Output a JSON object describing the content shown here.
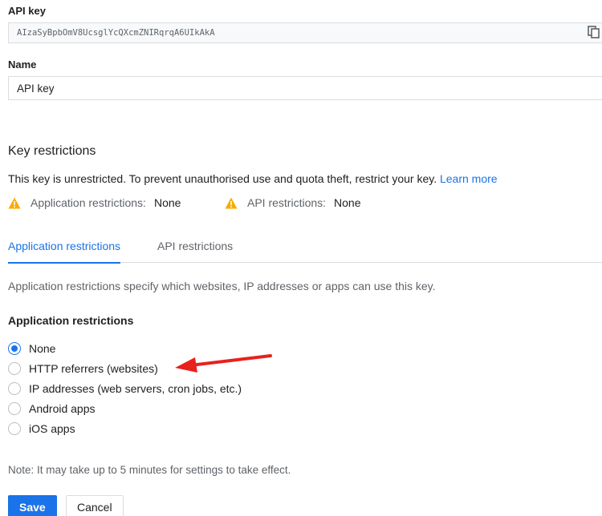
{
  "api_key": {
    "label": "API key",
    "value": "AIzaSyBpbOmV8UcsglYcQXcmZNIRqrqA6UIkAkA",
    "copy_icon": "copy-icon"
  },
  "name": {
    "label": "Name",
    "value": "API key"
  },
  "key_restrictions": {
    "title": "Key restrictions",
    "message": "This key is unrestricted. To prevent unauthorised use and quota theft, restrict your key.",
    "learn_more": "Learn more",
    "app_status": {
      "label": "Application restrictions:",
      "value": "None",
      "icon": "warning-icon"
    },
    "api_status": {
      "label": "API restrictions:",
      "value": "None",
      "icon": "warning-icon"
    }
  },
  "tabs": {
    "application": "Application restrictions",
    "api": "API restrictions",
    "active": "application"
  },
  "application_restrictions": {
    "description": "Application restrictions specify which websites, IP addresses or apps can use this key.",
    "title": "Application restrictions",
    "options": [
      {
        "label": "None",
        "selected": true
      },
      {
        "label": "HTTP referrers (websites)",
        "selected": false
      },
      {
        "label": "IP addresses (web servers, cron jobs, etc.)",
        "selected": false
      },
      {
        "label": "Android apps",
        "selected": false
      },
      {
        "label": "iOS apps",
        "selected": false
      }
    ]
  },
  "note": "Note: It may take up to 5 minutes for settings to take effect.",
  "buttons": {
    "save": "Save",
    "cancel": "Cancel"
  },
  "colors": {
    "accent": "#1a73e8",
    "warning": "#f9ab00",
    "annotation_arrow": "#e8211c"
  }
}
